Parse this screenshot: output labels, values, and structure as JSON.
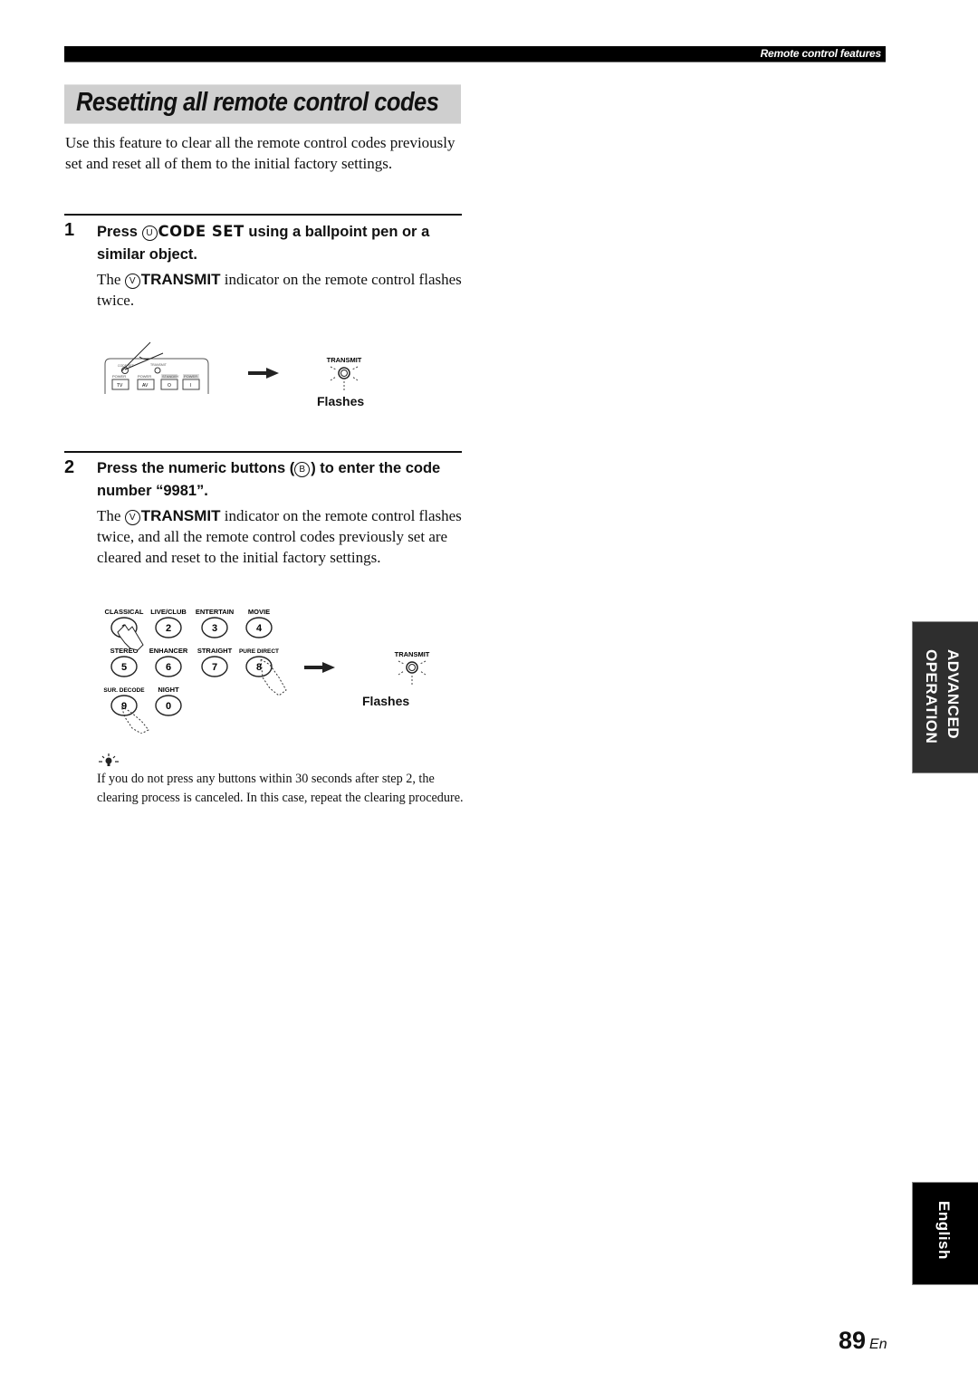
{
  "header": {
    "section_title": "Remote control features"
  },
  "page": {
    "title": "Resetting all remote control codes",
    "intro": "Use this feature to clear all the remote control codes previously set and reset all of them to the initial factory settings."
  },
  "steps": [
    {
      "number": "1",
      "head_pre": "Press ",
      "head_key_marker": "U",
      "head_key": "CODE SET",
      "head_post": " using a ballpoint pen or a similar object.",
      "body_pre": "The ",
      "body_key_marker": "V",
      "body_key": "TRANSMIT",
      "body_post": " indicator on the remote control flashes twice.",
      "figure": {
        "remote_labels": [
          "CODE SET",
          "TRANSMIT"
        ],
        "power_labels": [
          "POWER",
          "POWER",
          "STANDBY",
          "POWER"
        ],
        "buttons": [
          "TV",
          "AV",
          "O",
          "I"
        ],
        "indicator_label": "TRANSMIT",
        "caption": "Flashes"
      }
    },
    {
      "number": "2",
      "head_pre": "Press the numeric buttons (",
      "head_key_marker": "B",
      "head_post": ") to enter the code number “9981”.",
      "body_pre": "The ",
      "body_key_marker": "V",
      "body_key": "TRANSMIT",
      "body_post": " indicator on the remote control flashes twice, and all the remote control codes previously set are cleared and reset to the initial factory settings.",
      "figure": {
        "keypad": [
          {
            "label": "CLASSICAL",
            "key": "1"
          },
          {
            "label": "LIVE/CLUB",
            "key": "2"
          },
          {
            "label": "ENTERTAIN",
            "key": "3"
          },
          {
            "label": "MOVIE",
            "key": "4"
          },
          {
            "label": "STEREO",
            "key": "5"
          },
          {
            "label": "ENHANCER",
            "key": "6"
          },
          {
            "label": "STRAIGHT",
            "key": "7"
          },
          {
            "label": "PURE DIRECT",
            "key": "8"
          },
          {
            "label": "SUR. DECODE",
            "key": "9"
          },
          {
            "label": "NIGHT",
            "key": "0"
          }
        ],
        "indicator_label": "TRANSMIT",
        "caption": "Flashes"
      }
    }
  ],
  "tip": {
    "icon": "lightbulb-tip-icon",
    "text": "If you do not press any buttons within 30 seconds after step 2, the clearing process is canceled. In this case, repeat the clearing procedure."
  },
  "side_tabs": {
    "section": [
      "ADVANCED",
      "OPERATION"
    ],
    "language": "English"
  },
  "footer": {
    "page_number": "89",
    "lang_code": "En"
  }
}
